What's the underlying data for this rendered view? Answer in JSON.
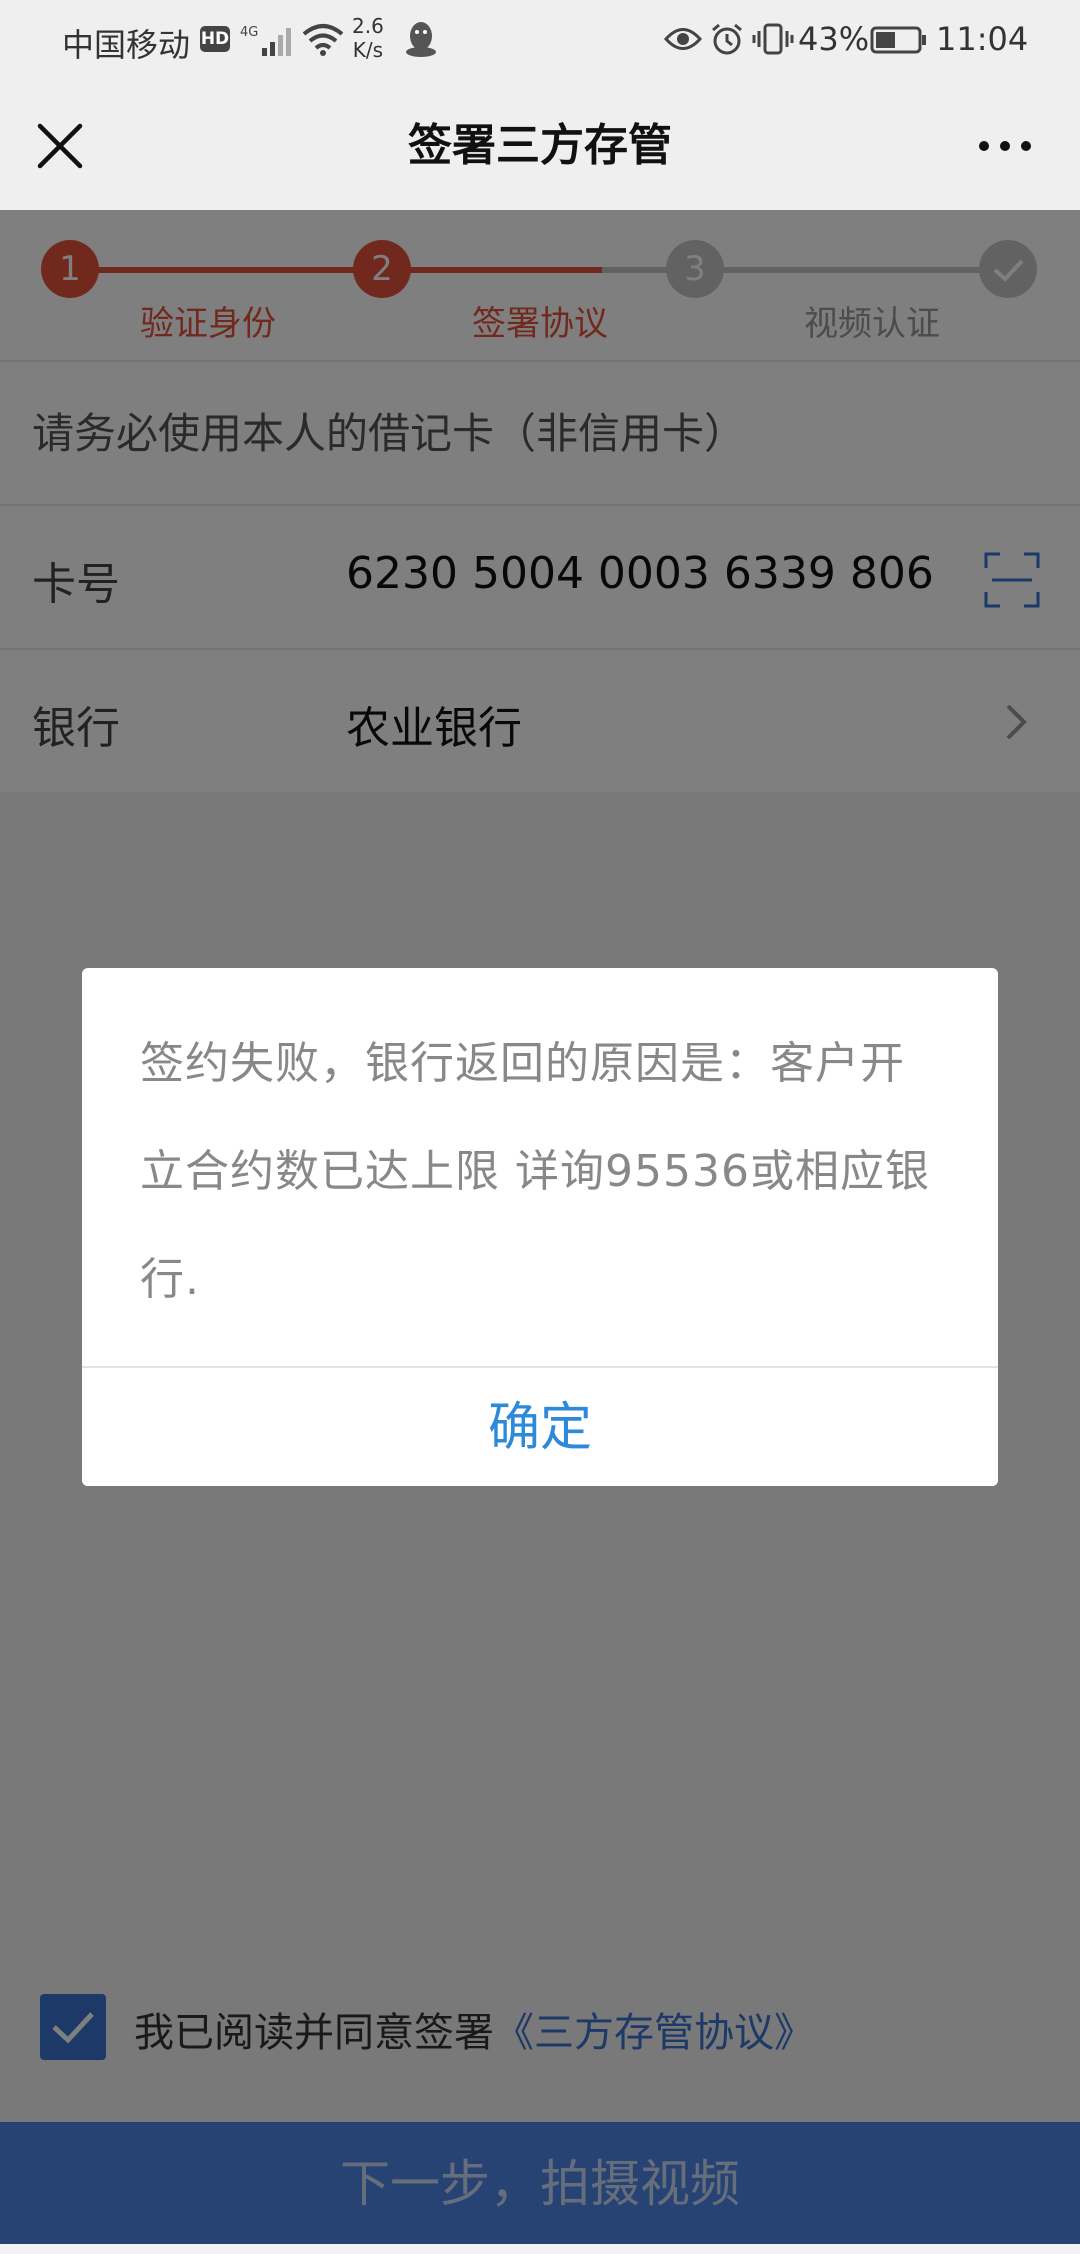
{
  "status_bar": {
    "carrier": "中国移动",
    "hd": "HD",
    "network": "4G",
    "speed_value": "2.6",
    "speed_unit": "K/s",
    "battery": "43%",
    "time": "11:04"
  },
  "header": {
    "title": "签署三方存管",
    "close_icon": "close-icon",
    "more_icon": "more-icon"
  },
  "steps": [
    {
      "number": "1",
      "label": "验证身份",
      "state": "done"
    },
    {
      "number": "2",
      "label": "签署协议",
      "state": "active"
    },
    {
      "number": "3",
      "label": "",
      "state": "pending"
    },
    {
      "number": "",
      "label": "视频认证",
      "state": "pending"
    }
  ],
  "form": {
    "notice": "请务必使用本人的借记卡（非信用卡）",
    "card_label": "卡号",
    "card_number": "6230 5004 0003 6339 806",
    "bank_label": "银行",
    "bank_value": "农业银行"
  },
  "agreement": {
    "checked": true,
    "text": "我已阅读并同意签署",
    "link": "《三方存管协议》"
  },
  "next_button": "下一步，拍摄视频",
  "dialog": {
    "message": "签约失败，银行返回的原因是：客户开立合约数已达上限 详询95536或相应银行.",
    "confirm": "确定"
  },
  "colors": {
    "accent_red": "#e2533b",
    "brand_blue": "#3b73cf",
    "dialog_button": "#2d8ad8"
  }
}
